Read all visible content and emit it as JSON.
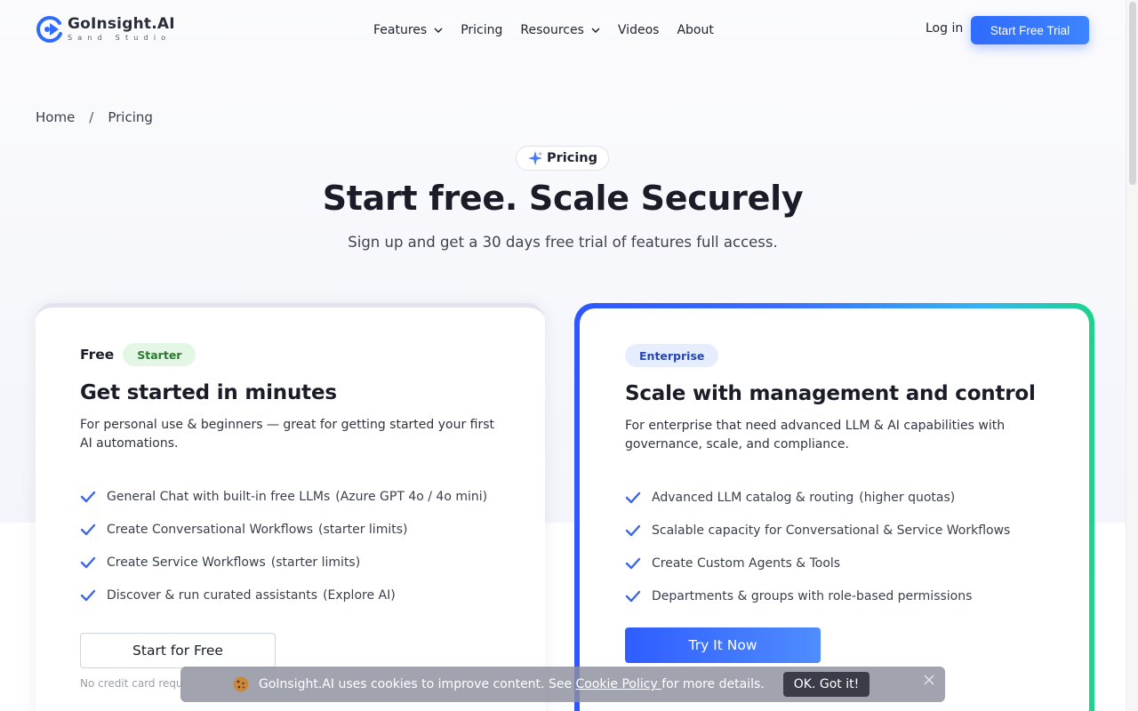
{
  "header": {
    "logo_name": "GoInsight.AI",
    "logo_sub": "Sand Studio",
    "nav": [
      {
        "label": "Features",
        "has_dropdown": true
      },
      {
        "label": "Pricing",
        "has_dropdown": false
      },
      {
        "label": "Resources",
        "has_dropdown": true
      },
      {
        "label": "Videos",
        "has_dropdown": false
      },
      {
        "label": "About",
        "has_dropdown": false
      }
    ],
    "login_label": "Log in",
    "trial_label": "Start Free Trial"
  },
  "breadcrumb": {
    "home": "Home",
    "separator": "/",
    "current": "Pricing"
  },
  "hero": {
    "pill_label": "Pricing",
    "title": "Start free. Scale Securely",
    "subtitle": "Sign up and get a 30 days free trial of features full access."
  },
  "free_card": {
    "tier": "Free",
    "badge": "Starter",
    "title": "Get started in minutes",
    "description": "For personal use & beginners — great for getting started your first AI automations.",
    "features": [
      {
        "text": "General Chat with built-in free LLMs",
        "note": "(Azure GPT 4o / 4o mini)"
      },
      {
        "text": "Create Conversational Workflows",
        "note": "(starter limits)"
      },
      {
        "text": "Create Service Workflows",
        "note": "(starter limits)"
      },
      {
        "text": "Discover & run curated assistants",
        "note": "(Explore AI)"
      }
    ],
    "button_label": "Start for Free",
    "footnote": "No credit card requ"
  },
  "enterprise_card": {
    "badge": "Enterprise",
    "title": "Scale with management and control",
    "description": "For enterprise that need advanced LLM & AI capabilities with governance, scale, and compliance.",
    "features": [
      {
        "text": "Advanced LLM catalog & routing",
        "note": "(higher quotas)"
      },
      {
        "text": "Scalable capacity for Conversational & Service Workflows",
        "note": ""
      },
      {
        "text": "Create Custom Agents & Tools",
        "note": ""
      },
      {
        "text": "Departments & groups with role-based permissions",
        "note": ""
      }
    ],
    "button_label": "Try It Now"
  },
  "cookie": {
    "text_before": "GoInsight.AI uses cookies to improve content. See ",
    "link_label": "Cookie Policy ",
    "text_after": "for more details.",
    "ok_label": "OK. Got it!"
  },
  "colors": {
    "accent": "#2f6bff",
    "check": "#3b66e8",
    "starter_badge_bg": "#e3f7e4",
    "enterprise_badge_bg": "#e5edff"
  },
  "icons": [
    "logo-mark-icon",
    "chevron-down-icon",
    "sparkle-icon",
    "check-icon",
    "cookie-icon",
    "close-icon"
  ]
}
